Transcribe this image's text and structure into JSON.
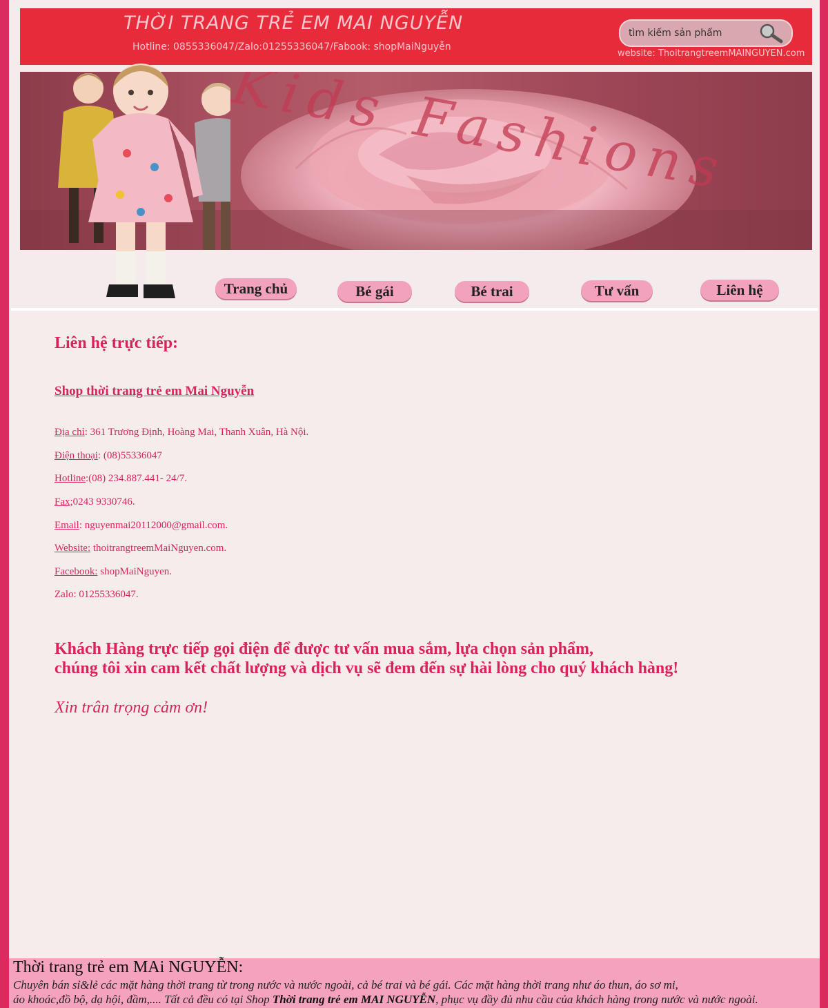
{
  "header": {
    "title": "THỜI TRANG TRẺ EM MAI NGUYỄN",
    "hotline_line": "Hotline: 0855336047/Zalo:01255336047/Fabook: shopMaiNguyễn",
    "search_placeholder": "tìm kiếm sản phẩm",
    "website_line": "website: ThoitrangtreemMAINGUYEN.com",
    "banner_text": "Kids Fashions"
  },
  "nav": {
    "items": [
      "Trang chủ",
      "Bé gái",
      "Bé trai",
      "Tư vấn",
      "Liên hệ"
    ]
  },
  "content": {
    "heading": "Liên hệ trực tiếp:",
    "shop_name": "Shop thời trang trẻ em Mai Nguyễn",
    "info": [
      {
        "label": "Địa chỉ",
        "value": ": 361 Trương Định, Hoàng Mai, Thanh Xuân, Hà Nội."
      },
      {
        "label": "Điện thoại",
        "value": ": (08)55336047"
      },
      {
        "label": "Hotline",
        "value": ":(08) 234.887.441- 24/7."
      },
      {
        "label": "Fax;",
        "value": "0243 9330746."
      },
      {
        "label": "Email",
        "value": ": nguyenmai20112000@gmail.com."
      },
      {
        "label": "Website:",
        "value": " thoitrangtreemMaiNguyen.com."
      },
      {
        "label": "Facebook:",
        "value": " shopMaiNguyen."
      },
      {
        "label": "",
        "value": "Zalo: 01255336047."
      }
    ],
    "closing_line1": "Khách Hàng trực tiếp gọi điện để được tư vấn mua sắm, lựa chọn sản phẩm,",
    "closing_line2": "chúng tôi xin cam kết chất lượng và dịch vụ sẽ đem đến sự hài lòng cho quý khách hàng!",
    "thanks": "Xin trân trọng cảm ơn!"
  },
  "footer": {
    "title": "Thời trang trẻ em MAi NGUYỄN:",
    "desc_line1": "Chuyên bán sỉ&lẻ các mặt hàng thời trang từ trong nước và nước ngoài, cả bé trai và bé gái. Các mặt hàng thời trang như áo thun, áo sơ mi,",
    "desc_line2_pre": "áo khoác,đồ bộ, dạ hội, đầm,.... Tất cả đều có tại Shop ",
    "desc_line2_bold": "Thời trang trẻ em MAI NGUYỄN",
    "desc_line2_post": ", phục vụ đầy đủ nhu cầu của khách hàng trong nước và nước ngoài."
  },
  "colors": {
    "border": "#db2a5e",
    "topbar": "#e82b3a",
    "accent_text": "#d8245a",
    "nav_button": "#f2a2bc",
    "footer_bg": "#f4a2bd"
  },
  "icons": [
    "search-icon",
    "banner-image",
    "kids-illustration"
  ]
}
